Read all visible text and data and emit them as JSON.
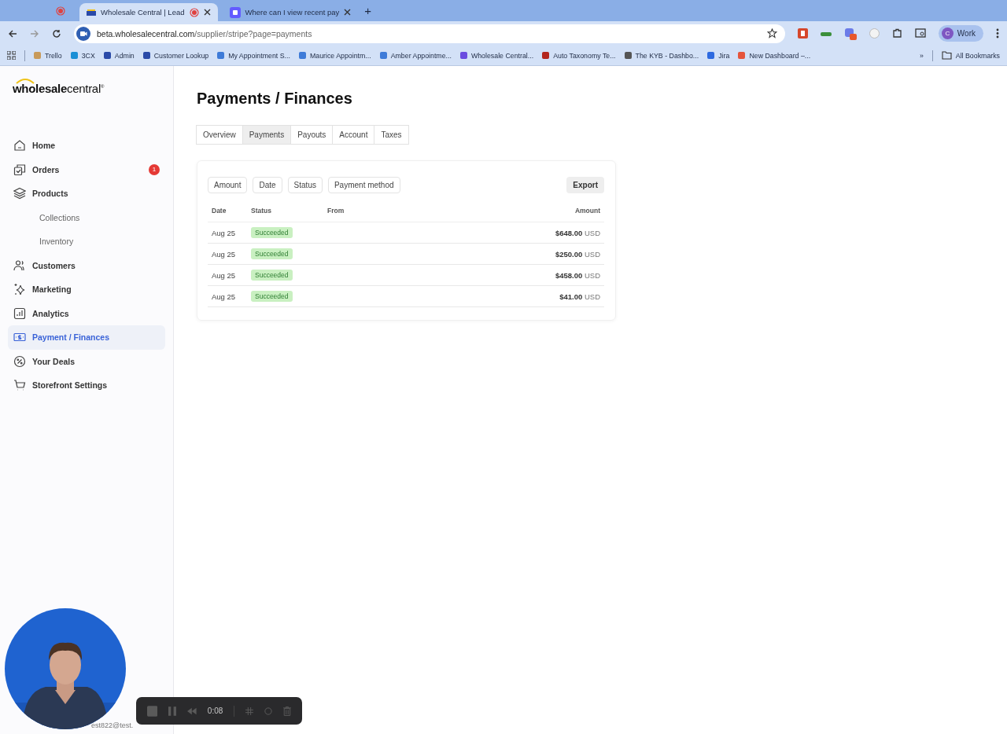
{
  "browser": {
    "tabs": [
      {
        "title": "Wholesale Central | Lead",
        "selected": true,
        "recording": true
      },
      {
        "title": "Where can I view recent pay",
        "selected": false,
        "recording": false
      }
    ],
    "new_tab": "+",
    "url_host": "beta.wholesalecentral.com",
    "url_path": "/supplier/stripe?page=payments",
    "profile": {
      "initial": "C",
      "name": "Work"
    },
    "bookmarks": [
      "Trello",
      "3CX",
      "Admin",
      "Customer Lookup",
      "My Appointment S...",
      "Maurice Appointm...",
      "Amber Appointme...",
      "Wholesale Central...",
      "Auto Taxonomy Te...",
      "The KYB - Dashbo...",
      "Jira",
      "New Dashboard –..."
    ],
    "more_bookmarks": "»",
    "all_bookmarks": "All Bookmarks"
  },
  "sidebar": {
    "logo": "**wholesale**central",
    "logo_mark": "®",
    "items": [
      {
        "label": "Home",
        "selected": false
      },
      {
        "label": "Orders",
        "selected": false,
        "badge": "1"
      },
      {
        "label": "Products",
        "selected": false,
        "children": [
          {
            "label": "Collections",
            "selected": false
          },
          {
            "label": "Inventory",
            "selected": false
          }
        ]
      },
      {
        "label": "Customers",
        "selected": false
      },
      {
        "label": "Marketing",
        "selected": false
      },
      {
        "label": "Analytics",
        "selected": false
      },
      {
        "label": "Payment / Finances",
        "selected": true
      },
      {
        "label": "Your Deals",
        "selected": false
      },
      {
        "label": "Storefront Settings",
        "selected": false
      }
    ],
    "account_email": "est822@test."
  },
  "page": {
    "title": "Payments / Finances",
    "tabs": [
      {
        "label": "Overview",
        "selected": false
      },
      {
        "label": "Payments",
        "selected": true
      },
      {
        "label": "Payouts",
        "selected": false
      },
      {
        "label": "Account",
        "selected": false
      },
      {
        "label": "Taxes",
        "selected": false
      }
    ],
    "filters": [
      "Amount",
      "Date",
      "Status",
      "Payment method"
    ],
    "export": "Export",
    "table": {
      "columns": [
        "Date",
        "Status",
        "From",
        "Amount"
      ],
      "rows": [
        {
          "date": "Aug 25",
          "status": "Succeeded",
          "amount": "$648.00",
          "currency": "USD"
        },
        {
          "date": "Aug 25",
          "status": "Succeeded",
          "amount": "$250.00",
          "currency": "USD"
        },
        {
          "date": "Aug 25",
          "status": "Succeeded",
          "amount": "$458.00",
          "currency": "USD"
        },
        {
          "date": "Aug 25",
          "status": "Succeeded",
          "amount": "$41.00",
          "currency": "USD"
        }
      ]
    }
  },
  "recorder": {
    "time": "0:08"
  }
}
